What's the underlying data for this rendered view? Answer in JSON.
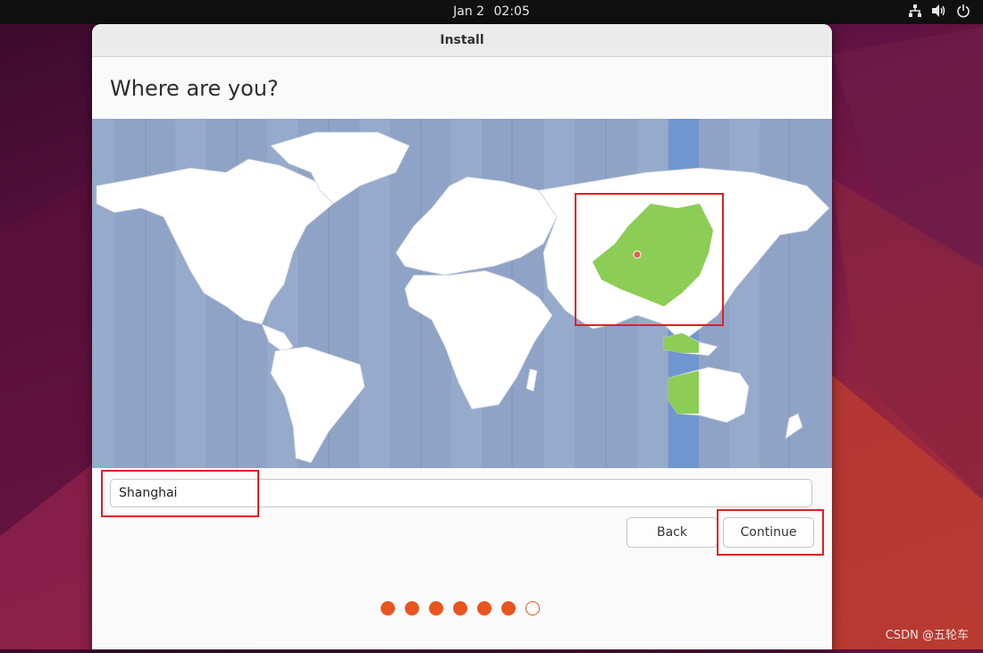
{
  "system_bar": {
    "date": "Jan 2",
    "time": "02:05",
    "icons": [
      "network-icon",
      "volume-icon",
      "power-icon"
    ]
  },
  "window": {
    "title": "Install",
    "heading": "Where are you?"
  },
  "location": {
    "value": "Shanghai"
  },
  "buttons": {
    "back": "Back",
    "continue": "Continue"
  },
  "progress": {
    "total_steps": 7,
    "completed_steps": 6
  },
  "watermark": "CSDN @五轮车",
  "colors": {
    "accent": "#e95420",
    "map_water": "#8fa3c6",
    "land": "#ffffff",
    "selected_timezone_land": "#8ccd55",
    "selected_timezone_band": "#7096cf",
    "annotation_red": "#e02020"
  }
}
